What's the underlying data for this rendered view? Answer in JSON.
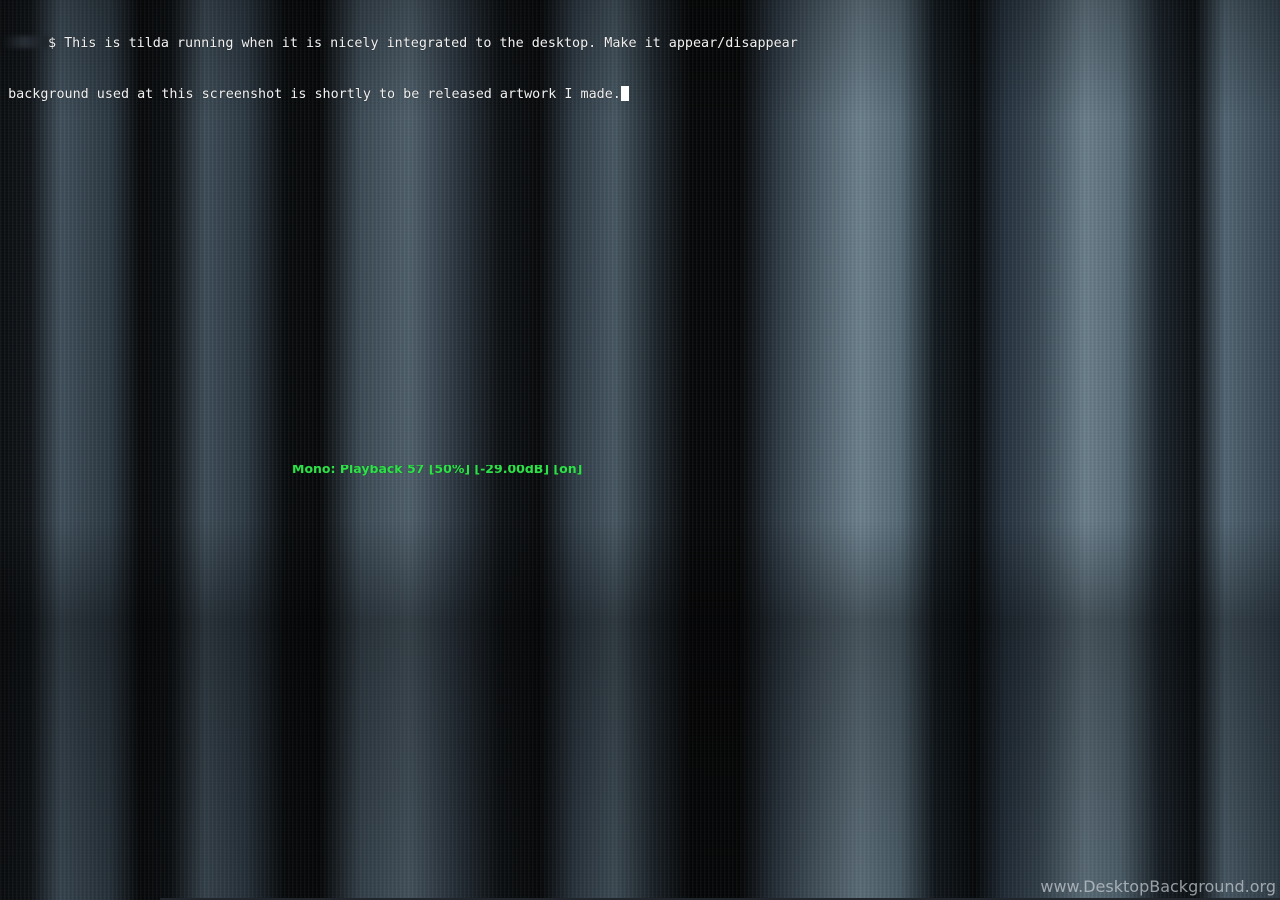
{
  "terminal": {
    "line_1_text": "$ This is tilda running when it is nicely integrated to the desktop. Make it appear/disappear",
    "line_2_text": "e background used at this screenshot is shortly to be released artwork I made."
  },
  "mixer_status": {
    "text": "Mono: Playback 57 [50%] [-29.00dB] [on]",
    "color": "#2fe04a"
  },
  "watermark": {
    "text": "www.DesktopBackground.org"
  },
  "icons": {
    "cursor": "block-cursor-icon"
  }
}
